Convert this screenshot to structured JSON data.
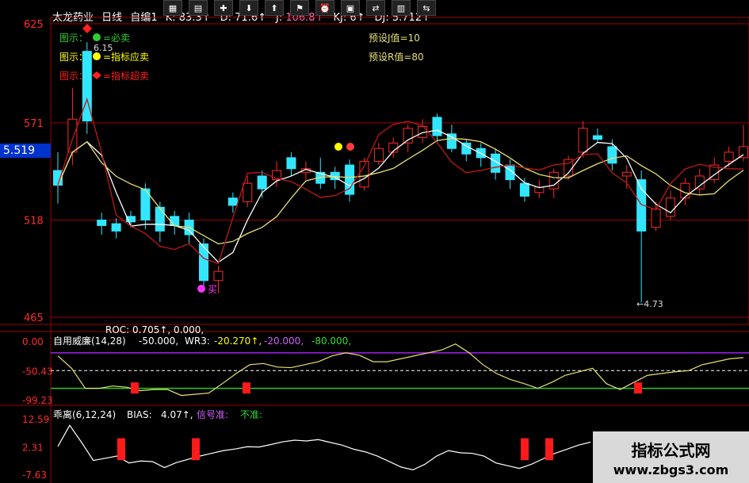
{
  "window": {
    "app_title": "太龙药业",
    "period": "日线",
    "indicator_header": "自编1",
    "indicators": [
      {
        "label": "K:",
        "value": "83.3",
        "arrow": "↑"
      },
      {
        "label": "D:",
        "value": "71.6",
        "arrow": "↑"
      },
      {
        "label": "J:",
        "value": "106.8",
        "arrow": "↑"
      },
      {
        "label": "KJ:",
        "value": "6",
        "arrow": "↑"
      },
      {
        "label": "DJ:",
        "value": "5.712",
        "arrow": "↑"
      }
    ]
  },
  "main_panel": {
    "axis": {
      "labels": [
        "625",
        "571",
        "518",
        "465"
      ]
    },
    "current_price": "5.519",
    "legend": [
      {
        "prefix": "图示：",
        "text": "=必卖",
        "color": "#33cc33"
      },
      {
        "prefix": "图示：",
        "text": "=指标应卖",
        "color": "#ffff00"
      },
      {
        "prefix": "图示：",
        "text": "=指标超卖",
        "color": "#ff2020"
      }
    ],
    "preset_j": "预设J值=10",
    "preset_r": "预设R值=80",
    "max_label": "6.15",
    "min_label": "←4.73",
    "buy_label": "买"
  },
  "panel_wr": {
    "axis": {
      "labels": [
        "0.00",
        "-50.43",
        "-99.23"
      ]
    },
    "roc_line": "ROC: 0.705↑, 0.000,",
    "name": "自用威廉(14,28)",
    "value1": "-50.000,",
    "wr3_label": "WR3:",
    "wr3_value": "-20.270↑,",
    "neg20": "-20.000,",
    "neg80": "-80.000,"
  },
  "panel_bias": {
    "axis": {
      "labels": [
        "12.59",
        "2.31",
        "-7.63"
      ]
    },
    "name": "乖离(6,12,24)",
    "bias_label": "BIAS:",
    "bias_value": "4.07↑,",
    "signal_label": "信号准:",
    "signal_value": "不准:"
  },
  "watermark": {
    "cn": "指标公式网",
    "url": "www.zbgs3.com"
  },
  "colors": {
    "up": "#ff2a2a",
    "down": "#33e6ff",
    "grid": "#a00000",
    "yellow": "#e8e070",
    "white": "#ffffff",
    "purple": "#a020f0",
    "green": "#33cc33"
  },
  "chart_data": [
    {
      "type": "candlestick",
      "ylim": [
        4.65,
        6.25
      ],
      "axis_ticks": [
        6.25,
        5.71,
        5.18,
        4.65
      ],
      "candles": [
        {
          "o": 5.45,
          "c": 5.37,
          "h": 5.55,
          "l": 5.27
        },
        {
          "o": 5.55,
          "c": 5.73,
          "h": 5.9,
          "l": 5.48
        },
        {
          "o": 6.1,
          "c": 5.72,
          "h": 6.15,
          "l": 5.65
        },
        {
          "o": 5.18,
          "c": 5.15,
          "h": 5.22,
          "l": 5.1
        },
        {
          "o": 5.16,
          "c": 5.12,
          "h": 5.19,
          "l": 5.08
        },
        {
          "o": 5.2,
          "c": 5.17,
          "h": 5.23,
          "l": 5.14
        },
        {
          "o": 5.35,
          "c": 5.18,
          "h": 5.38,
          "l": 5.13
        },
        {
          "o": 5.25,
          "c": 5.12,
          "h": 5.28,
          "l": 5.06
        },
        {
          "o": 5.2,
          "c": 5.15,
          "h": 5.23,
          "l": 5.1
        },
        {
          "o": 5.18,
          "c": 5.1,
          "h": 5.22,
          "l": 5.05
        },
        {
          "o": 5.05,
          "c": 4.85,
          "h": 5.08,
          "l": 4.82
        },
        {
          "o": 4.85,
          "c": 4.9,
          "h": 4.93,
          "l": 4.78
        },
        {
          "o": 5.3,
          "c": 5.26,
          "h": 5.33,
          "l": 5.22
        },
        {
          "o": 5.28,
          "c": 5.38,
          "h": 5.42,
          "l": 5.25
        },
        {
          "o": 5.42,
          "c": 5.35,
          "h": 5.45,
          "l": 5.3
        },
        {
          "o": 5.4,
          "c": 5.45,
          "h": 5.5,
          "l": 5.36
        },
        {
          "o": 5.52,
          "c": 5.46,
          "h": 5.55,
          "l": 5.42
        },
        {
          "o": 5.44,
          "c": 5.46,
          "h": 5.5,
          "l": 5.4
        },
        {
          "o": 5.44,
          "c": 5.38,
          "h": 5.52,
          "l": 5.35
        },
        {
          "o": 5.44,
          "c": 5.4,
          "h": 5.47,
          "l": 5.35
        },
        {
          "o": 5.48,
          "c": 5.32,
          "h": 5.51,
          "l": 5.28
        },
        {
          "o": 5.36,
          "c": 5.5,
          "h": 5.52,
          "l": 5.34
        },
        {
          "o": 5.5,
          "c": 5.57,
          "h": 5.6,
          "l": 5.48
        },
        {
          "o": 5.55,
          "c": 5.6,
          "h": 5.63,
          "l": 5.52
        },
        {
          "o": 5.6,
          "c": 5.68,
          "h": 5.7,
          "l": 5.55
        },
        {
          "o": 5.63,
          "c": 5.69,
          "h": 5.73,
          "l": 5.6
        },
        {
          "o": 5.74,
          "c": 5.64,
          "h": 5.76,
          "l": 5.6
        },
        {
          "o": 5.65,
          "c": 5.57,
          "h": 5.7,
          "l": 5.55
        },
        {
          "o": 5.6,
          "c": 5.54,
          "h": 5.62,
          "l": 5.5
        },
        {
          "o": 5.57,
          "c": 5.52,
          "h": 5.6,
          "l": 5.47
        },
        {
          "o": 5.54,
          "c": 5.44,
          "h": 5.57,
          "l": 5.4
        },
        {
          "o": 5.48,
          "c": 5.4,
          "h": 5.51,
          "l": 5.35
        },
        {
          "o": 5.38,
          "c": 5.31,
          "h": 5.41,
          "l": 5.28
        },
        {
          "o": 5.33,
          "c": 5.36,
          "h": 5.4,
          "l": 5.3
        },
        {
          "o": 5.35,
          "c": 5.44,
          "h": 5.46,
          "l": 5.3
        },
        {
          "o": 5.42,
          "c": 5.51,
          "h": 5.53,
          "l": 5.4
        },
        {
          "o": 5.55,
          "c": 5.68,
          "h": 5.72,
          "l": 5.52
        },
        {
          "o": 5.64,
          "c": 5.62,
          "h": 5.68,
          "l": 5.6
        },
        {
          "o": 5.58,
          "c": 5.49,
          "h": 5.62,
          "l": 5.45
        },
        {
          "o": 5.42,
          "c": 5.44,
          "h": 5.48,
          "l": 5.35
        },
        {
          "o": 5.4,
          "c": 5.12,
          "h": 5.45,
          "l": 4.73
        },
        {
          "o": 5.14,
          "c": 5.24,
          "h": 5.28,
          "l": 5.12
        },
        {
          "o": 5.2,
          "c": 5.3,
          "h": 5.34,
          "l": 5.18
        },
        {
          "o": 5.3,
          "c": 5.38,
          "h": 5.41,
          "l": 5.26
        },
        {
          "o": 5.35,
          "c": 5.42,
          "h": 5.46,
          "l": 5.32
        },
        {
          "o": 5.4,
          "c": 5.48,
          "h": 5.52,
          "l": 5.38
        },
        {
          "o": 5.5,
          "c": 5.55,
          "h": 5.58,
          "l": 5.47
        },
        {
          "o": 5.52,
          "c": 5.58,
          "h": 5.7,
          "l": 5.5
        }
      ]
    },
    {
      "type": "line",
      "name": "自用威廉(14,28)",
      "ylim": [
        -99.23,
        0.0
      ],
      "series_yellow": [
        -25,
        -46,
        -80,
        -80,
        -76,
        -78,
        -84,
        -82,
        -82,
        -92,
        -90,
        -88,
        -72,
        -55,
        -40,
        -38,
        -44,
        -45,
        -40,
        -35,
        -25,
        -20,
        -24,
        -35,
        -35,
        -30,
        -25,
        -20,
        -15,
        -5,
        -20,
        -40,
        -55,
        -65,
        -72,
        -80,
        -70,
        -58,
        -52,
        -46,
        -72,
        -82,
        -70,
        -58,
        -55,
        -52,
        -50,
        -40,
        -35,
        -30,
        -28
      ],
      "bars_at": [
        8,
        21,
        65
      ]
    },
    {
      "type": "line",
      "name": "乖离(6,12,24)",
      "ylim": [
        -7.63,
        12.59
      ],
      "series_white": [
        2.5,
        10.2,
        4.0,
        -2.6,
        -1.8,
        -1.0,
        -3.5,
        -2.8,
        -3.0,
        -5.2,
        -3.4,
        -2.2,
        -1.0,
        0.0,
        1.0,
        1.6,
        2.4,
        2.3,
        3.2,
        4.2,
        4.8,
        4.5,
        5.0,
        4.0,
        3.0,
        1.5,
        0.5,
        -1.0,
        -3.0,
        -5.0,
        -6.0,
        -4.0,
        -1.0,
        1.0,
        0.2,
        0.0,
        -1.0,
        -3.5,
        -4.5,
        -5.5,
        -4.0,
        -2.0,
        0.0,
        1.5,
        3.0,
        4.07
      ],
      "bars_at": [
        7,
        11,
        30,
        32
      ]
    }
  ]
}
